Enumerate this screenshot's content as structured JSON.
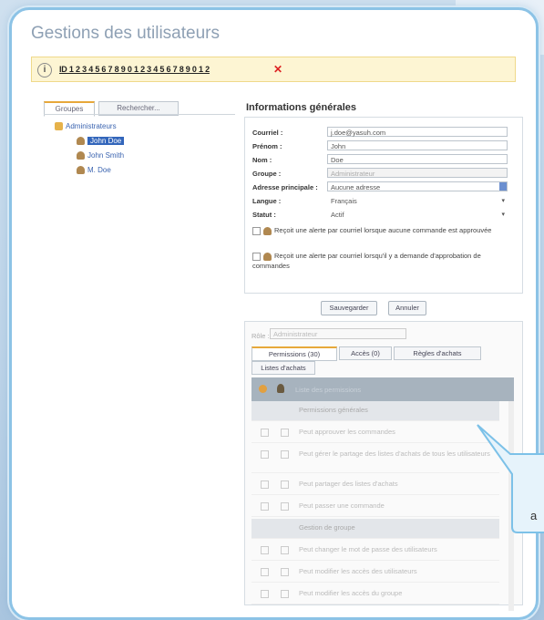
{
  "page": {
    "title": "Gestions des utilisateurs",
    "alert_text": "ID 1 2 3 4 5 6 7 8 9 0 1 2 3 4 5 6 7 8 9 0 1 2",
    "alert_close": "✕"
  },
  "left_tabs": [
    "Groupes",
    "Rechercher..."
  ],
  "tree": {
    "root": "Administrateurs",
    "users": [
      "John Doe",
      "John Smith",
      "M. Doe"
    ]
  },
  "form": {
    "title": "Informations générales",
    "fields": [
      {
        "label": "Courriel :",
        "value": "j.doe@yasuh.com"
      },
      {
        "label": "Prénom :",
        "value": "John"
      },
      {
        "label": "Nom :",
        "value": "Doe"
      },
      {
        "label": "Groupe :",
        "value": "Administrateur"
      },
      {
        "label": "Adresse principale :",
        "value": "Aucune adresse"
      },
      {
        "label": "Langue :",
        "value": "Français"
      },
      {
        "label": "Statut :",
        "value": "Actif"
      }
    ],
    "checkbox1": "Reçoit une alerte par courriel lorsque aucune commande est approuvée",
    "checkbox2": "Reçoit une alerte par courriel lorsqu'il y a demande d'approbation de commandes"
  },
  "buttons": {
    "save": "Sauvegarder",
    "cancel": "Annuler"
  },
  "permissions": {
    "role_label": "Rôle :",
    "role_value": "Administrateur",
    "tabs": [
      "Permissions (30)",
      "Accès (0)",
      "Règles d'achats",
      "Listes d'achats"
    ],
    "header": "Liste des permissions",
    "rows": [
      {
        "type": "group",
        "label": "Permissions générales"
      },
      {
        "type": "item",
        "label": "Peut approuver les commandes"
      },
      {
        "type": "item",
        "label": "Peut gérer le partage des listes d'achats de tous les utilisateurs"
      },
      {
        "type": "item",
        "label": "Peut partager des listes d'achats"
      },
      {
        "type": "item",
        "label": "Peut passer une commande"
      },
      {
        "type": "group",
        "label": "Gestion de groupe"
      },
      {
        "type": "item",
        "label": "Peut changer le mot de passe des utilisateurs"
      },
      {
        "type": "item",
        "label": "Peut modifier les accès des utilisateurs"
      },
      {
        "type": "item",
        "label": "Peut modifier les accès du groupe"
      }
    ]
  },
  "bubble_text": "a",
  "colors": {
    "accent": "#e7a83a",
    "frame": "#8cc3e6",
    "selection": "#3366bb",
    "alert_bg": "#fdf5d3"
  }
}
